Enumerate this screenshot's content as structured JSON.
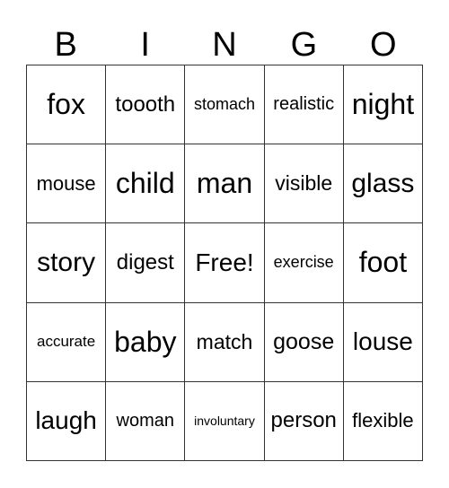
{
  "header": [
    "B",
    "I",
    "N",
    "G",
    "O"
  ],
  "cells": [
    "fox",
    "toooth",
    "stomach",
    "realistic",
    "night",
    "mouse",
    "child",
    "man",
    "visible",
    "glass",
    "story",
    "digest",
    "Free!",
    "exercise",
    "foot",
    "accurate",
    "baby",
    "match",
    "goose",
    "louse",
    "laugh",
    "woman",
    "involuntary",
    "person",
    "flexible"
  ]
}
